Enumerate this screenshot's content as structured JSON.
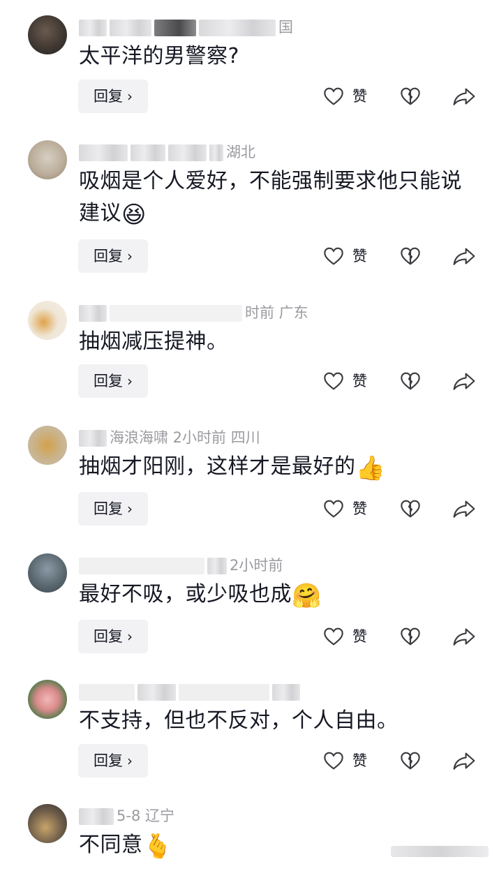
{
  "reply_label": "回复",
  "like_label": "赞",
  "colors": {
    "background": "#ffffff",
    "text": "#161823",
    "meta": "#9a9aa0",
    "button_bg": "#f2f2f4"
  },
  "comments": [
    {
      "meta_visible": "国",
      "text": "太平洋的男警察?",
      "emoji": ""
    },
    {
      "meta_visible": "湖北",
      "text": "吸烟是个人爱好，不能强制要求他只能说建议",
      "emoji": "😆"
    },
    {
      "meta_visible": "时前  广东",
      "text": "抽烟减压提神。",
      "emoji": ""
    },
    {
      "meta_visible": "海浪海啸  2小时前  四川",
      "text": "抽烟才阳刚，这样才是最好的",
      "emoji": "👍"
    },
    {
      "meta_visible": "2小时前",
      "text": "最好不吸，或少吸也成",
      "emoji": "🤗"
    },
    {
      "meta_visible": "",
      "text": "不支持，但也不反对，个人自由。",
      "emoji": ""
    },
    {
      "meta_visible": "5-8  辽宁",
      "text": "不同意",
      "emoji": "🫰"
    }
  ]
}
